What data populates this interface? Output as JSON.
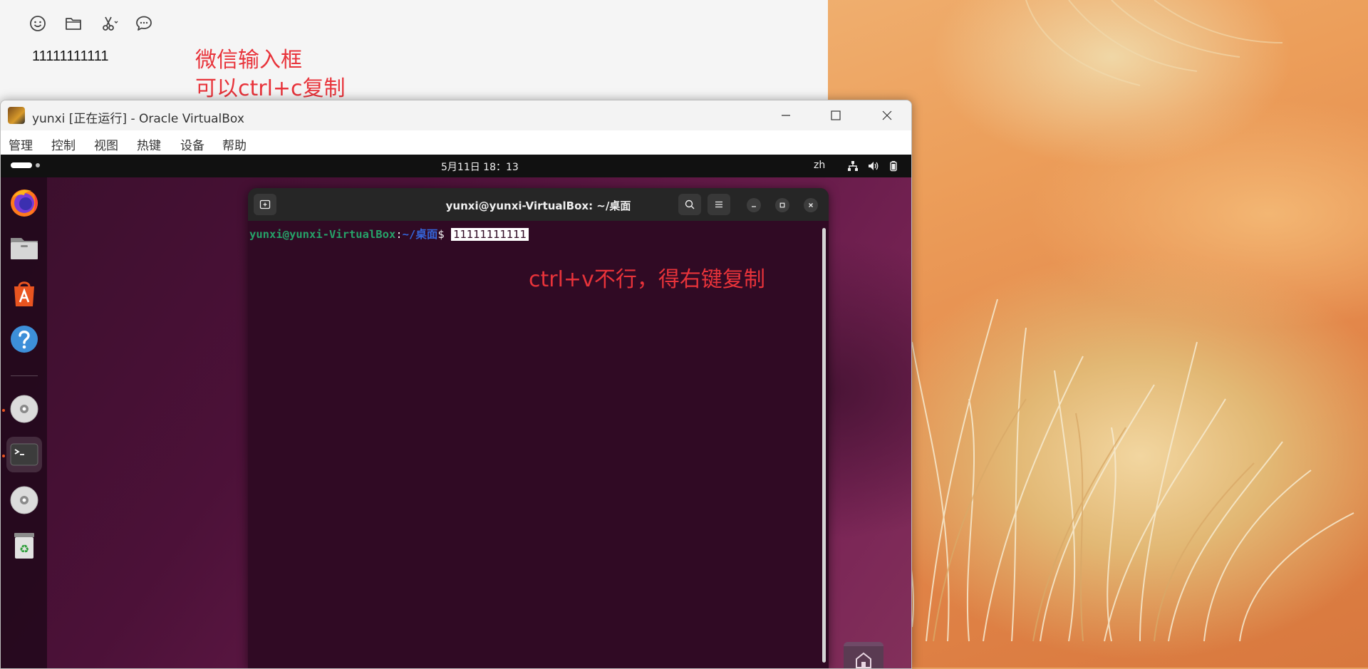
{
  "wechat": {
    "input_text": "11111111111",
    "annotation_line1": "微信输入框",
    "annotation_line2": "可以ctrl+c复制",
    "toolbar": [
      "emoji-icon",
      "folder-icon",
      "scissors-icon",
      "chat-bubble-icon"
    ]
  },
  "vbox": {
    "title": "yunxi [正在运行] - Oracle VirtualBox",
    "menu": [
      "管理",
      "控制",
      "视图",
      "热键",
      "设备",
      "帮助"
    ]
  },
  "ubuntu": {
    "clock": "5月11日 18：13",
    "lang": "zh",
    "dock": [
      "firefox-icon",
      "files-icon",
      "app-center-icon",
      "help-icon",
      "disc-icon",
      "terminal-icon",
      "disc-icon",
      "trash-icon"
    ]
  },
  "terminal": {
    "title": "yunxi@yunxi-VirtualBox: ~/桌面",
    "prompt_user": "yunxi@yunxi-VirtualBox",
    "prompt_colon": ":",
    "prompt_path": "~/桌面",
    "prompt_dollar": "$ ",
    "typed": "11111111111",
    "annotation": "ctrl+v不行，得右键复制"
  },
  "colors": {
    "annotation_red": "#e8333a",
    "terminal_bg": "#300a24",
    "prompt_green": "#26a269",
    "prompt_blue": "#3465d9",
    "ubuntu_orange": "#e95420"
  }
}
